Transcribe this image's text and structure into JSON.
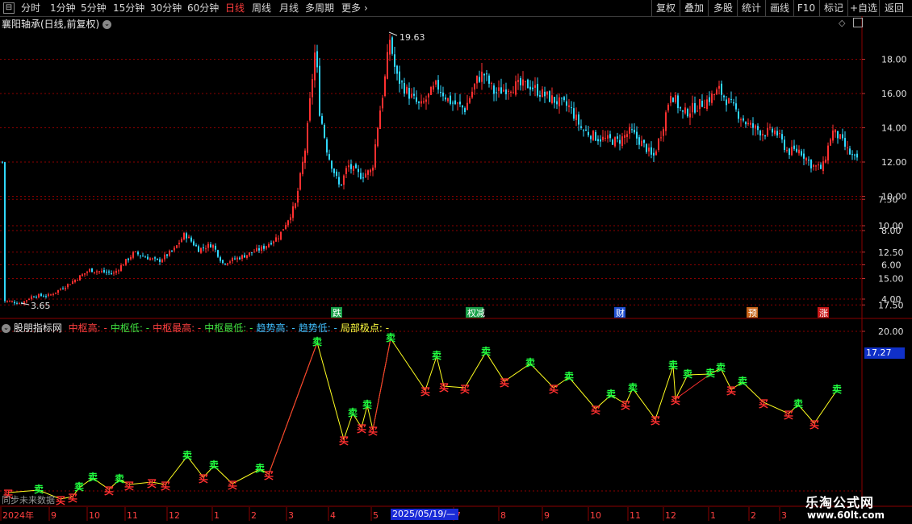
{
  "toolbar": {
    "left_items": [
      {
        "label": "分时",
        "active": false
      },
      {
        "label": "1分钟",
        "active": false
      },
      {
        "label": "5分钟",
        "active": false
      },
      {
        "label": "15分钟",
        "active": false
      },
      {
        "label": "30分钟",
        "active": false
      },
      {
        "label": "60分钟",
        "active": false
      },
      {
        "label": "日线",
        "active": true
      },
      {
        "label": "周线",
        "active": false
      },
      {
        "label": "月线",
        "active": false
      },
      {
        "label": "多周期",
        "active": false
      },
      {
        "label": "更多",
        "active": false
      }
    ],
    "right_items": [
      "复权",
      "叠加",
      "多股",
      "统计",
      "画线",
      "F10",
      "标记",
      "+自选",
      "返回"
    ]
  },
  "main_panel": {
    "title": "襄阳轴承(日线,前复权)",
    "y_ticks": [
      "18.00",
      "16.00",
      "14.00",
      "12.00",
      "10.00",
      "8.00",
      "6.00",
      "4.00"
    ],
    "high_label": "19.63",
    "low_label": "3.65",
    "event_tags": [
      {
        "label": "跌",
        "color": "#18a048"
      },
      {
        "label": "权减",
        "color": "#18a048"
      },
      {
        "label": "财",
        "color": "#2050d0"
      },
      {
        "label": "预",
        "color": "#c86418"
      },
      {
        "label": "涨",
        "color": "#c81818"
      }
    ]
  },
  "indicator_panel": {
    "name": "股朋指标网",
    "legend": [
      {
        "label": "中枢高: -",
        "color": "#ff4040"
      },
      {
        "label": "中枢低: -",
        "color": "#40e040"
      },
      {
        "label": "中枢最高: -",
        "color": "#ff4040"
      },
      {
        "label": "中枢最低: -",
        "color": "#40e040"
      },
      {
        "label": "趋势高: -",
        "color": "#40c0ff"
      },
      {
        "label": "趋势低: -",
        "color": "#40c0ff"
      },
      {
        "label": "局部极点: -",
        "color": "#ffff40"
      }
    ],
    "y_ticks": [
      "20.00",
      "17.50",
      "15.00",
      "12.50",
      "10.00",
      "7.50"
    ],
    "current_value": "17.27",
    "sell_label": "卖",
    "buy_label": "买",
    "bottom_left_text": "同步未来数据"
  },
  "time_axis": {
    "labels": [
      "2024年",
      "9",
      "10",
      "11",
      "12",
      "1",
      "2",
      "3",
      "4",
      "5",
      "7",
      "8",
      "9",
      "10",
      "11",
      "12",
      "1",
      "2",
      "3"
    ],
    "cursor_date": "2025/05/19/—"
  },
  "watermark": {
    "line1": "乐淘公式网",
    "line2": "www.60lt.com"
  },
  "colors": {
    "up": "#ff3030",
    "down": "#30d8ff",
    "grid": "#8b0000",
    "zigzag": "#ffff20"
  }
}
